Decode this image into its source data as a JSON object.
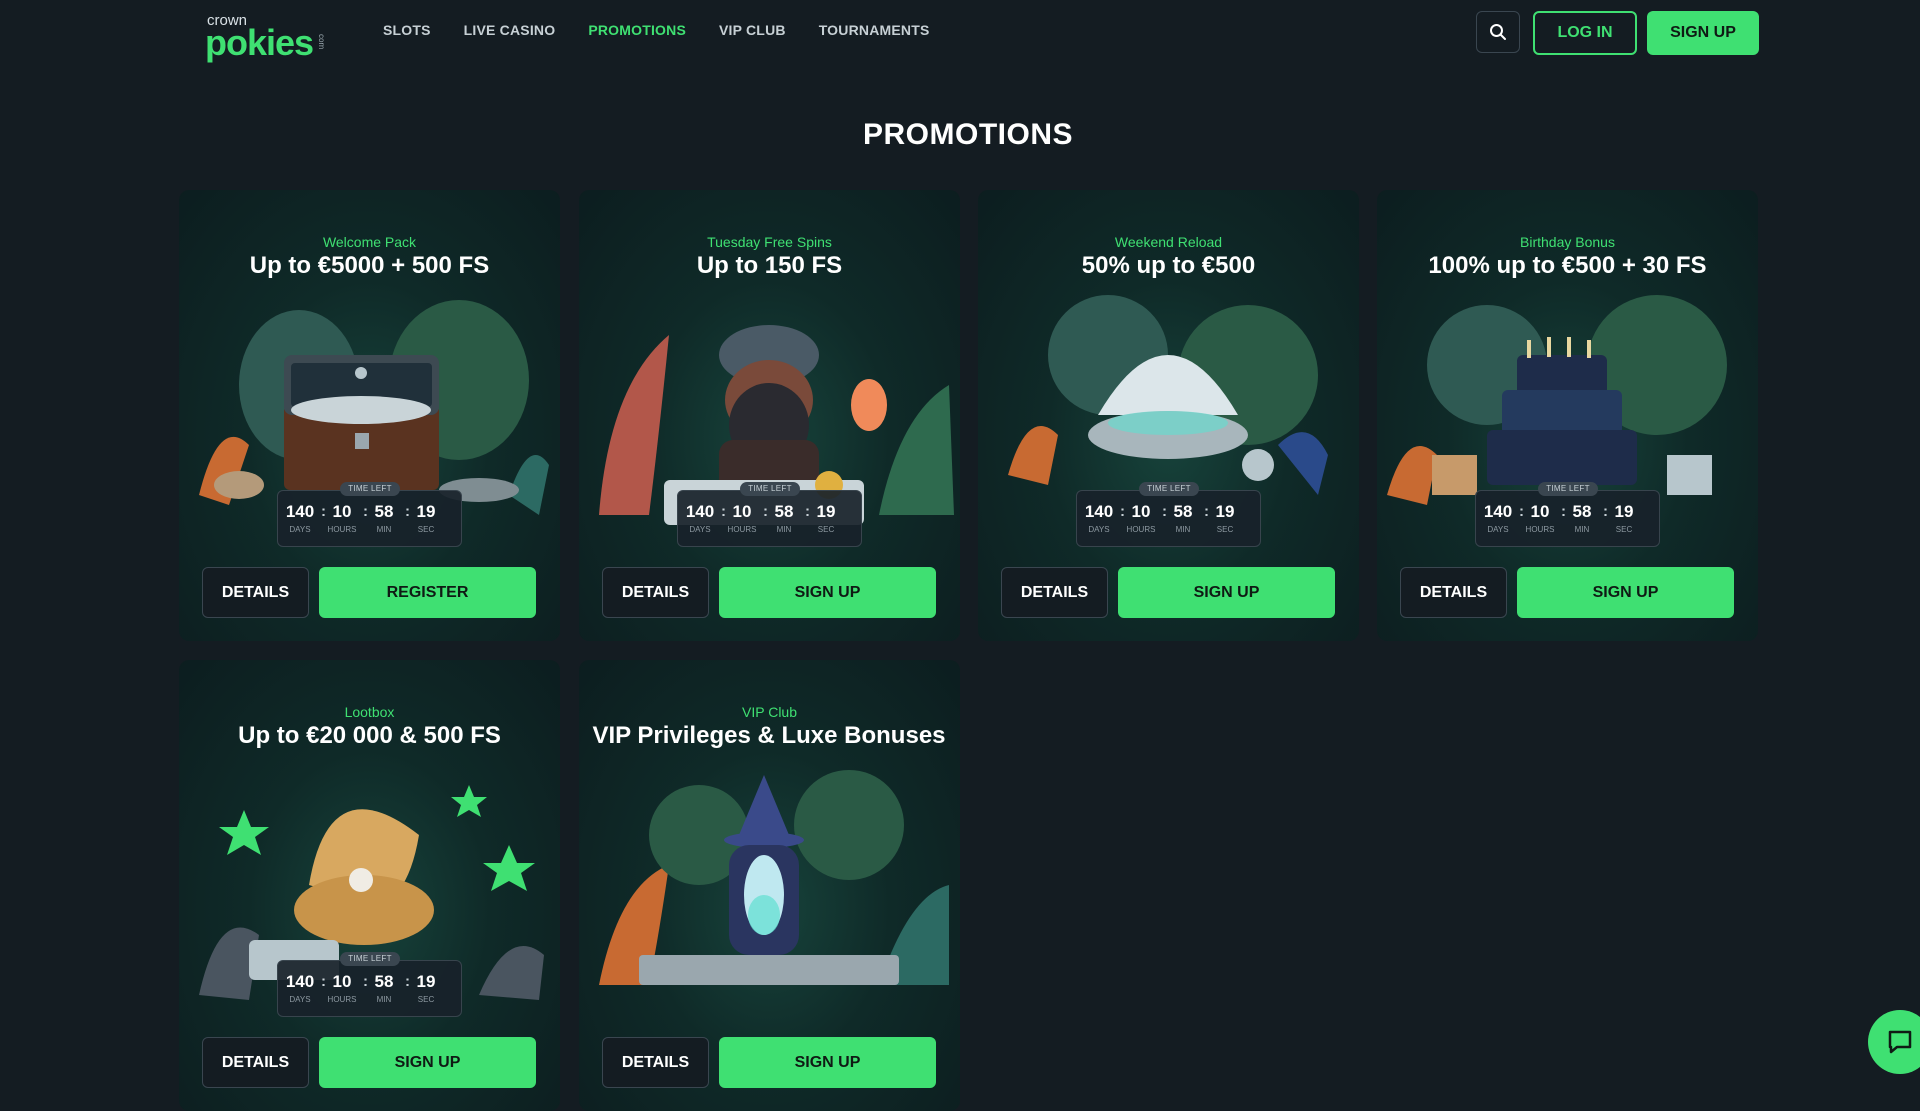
{
  "header": {
    "logo": {
      "crown": "crown",
      "main": "pokies",
      "tag": "com"
    },
    "nav": [
      {
        "label": "SLOTS"
      },
      {
        "label": "LIVE CASINO"
      },
      {
        "label": "PROMOTIONS"
      },
      {
        "label": "VIP CLUB"
      },
      {
        "label": "TOURNAMENTS"
      }
    ],
    "login_label": "LOG IN",
    "signup_label": "SIGN UP"
  },
  "page_title": "PROMOTIONS",
  "timer_label": "TIME LEFT",
  "timer_units": {
    "days": "DAYS",
    "hours": "HOURS",
    "min": "MIN",
    "sec": "SEC"
  },
  "details_label": "DETAILS",
  "promotions": [
    {
      "subtitle": "Welcome Pack",
      "title": "Up to €5000 + 500 FS",
      "timer": {
        "days": "140",
        "hours": "10",
        "min": "58",
        "sec": "19"
      },
      "cta": "REGISTER",
      "art": "treasure-chest"
    },
    {
      "subtitle": "Tuesday Free Spins",
      "title": "Up to 150 FS",
      "timer": {
        "days": "140",
        "hours": "10",
        "min": "58",
        "sec": "19"
      },
      "cta": "SIGN UP",
      "art": "dwarf-thumbs-up"
    },
    {
      "subtitle": "Weekend Reload",
      "title": "50% up to €500",
      "timer": {
        "days": "140",
        "hours": "10",
        "min": "58",
        "sec": "19"
      },
      "cta": "SIGN UP",
      "art": "seashell-coins"
    },
    {
      "subtitle": "Birthday Bonus",
      "title": "100% up to €500 + 30 FS",
      "timer": {
        "days": "140",
        "hours": "10",
        "min": "58",
        "sec": "19"
      },
      "cta": "SIGN UP",
      "art": "birthday-cake"
    },
    {
      "subtitle": "Lootbox",
      "title": "Up to €20 000 & 500 FS",
      "timer": {
        "days": "140",
        "hours": "10",
        "min": "58",
        "sec": "19"
      },
      "cta": "SIGN UP",
      "art": "golden-clam"
    },
    {
      "subtitle": "VIP Club",
      "title": "VIP Privileges & Luxe Bonuses",
      "timer": null,
      "cta": "SIGN UP",
      "art": "wizard-crystal"
    }
  ],
  "colors": {
    "accent": "#3fe072",
    "background": "#141c22",
    "card": "#0f2a28"
  }
}
